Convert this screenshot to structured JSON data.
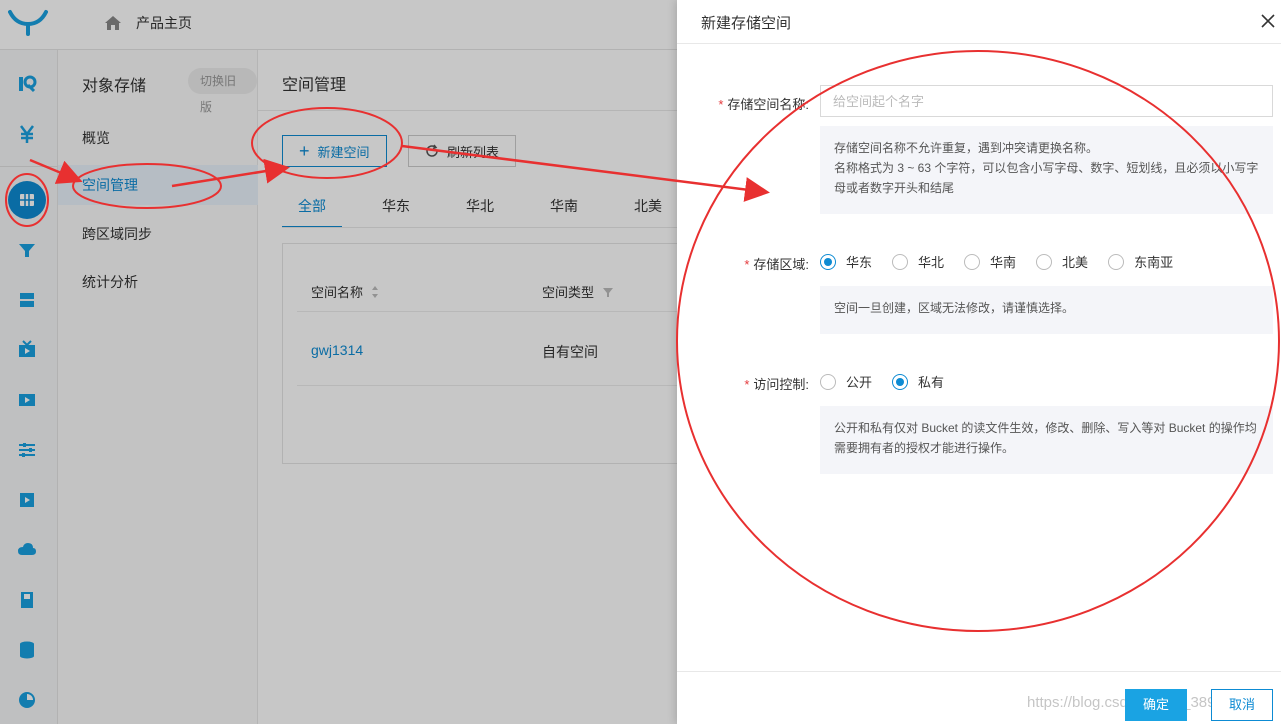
{
  "topbar": {
    "home_label": "产品主页"
  },
  "sidenav": {
    "title": "对象存储",
    "switch_label": "切换旧版",
    "items": [
      {
        "label": "概览"
      },
      {
        "label": "空间管理"
      },
      {
        "label": "跨区域同步"
      },
      {
        "label": "统计分析"
      }
    ]
  },
  "main": {
    "title": "空间管理",
    "new_bucket_label": "新建空间",
    "refresh_label": "刷新列表",
    "region_tabs": [
      "全部",
      "华东",
      "华北",
      "华南",
      "北美"
    ],
    "table": {
      "columns": [
        "空间名称",
        "空间类型"
      ],
      "rows": [
        {
          "name": "gwj1314",
          "type": "自有空间"
        }
      ]
    }
  },
  "drawer": {
    "title": "新建存储空间",
    "name_label": "存储空间名称:",
    "name_placeholder": "给空间起个名字",
    "name_tip_1": "存储空间名称不允许重复，遇到冲突请更换名称。",
    "name_tip_2": "名称格式为 3 ~ 63 个字符，可以包含小写字母、数字、短划线，且必须以小写字母或者数字开头和结尾",
    "region_label": "存储区域:",
    "regions": [
      "华东",
      "华北",
      "华南",
      "北美",
      "东南亚"
    ],
    "region_selected": "华东",
    "region_tip": "空间一旦创建，区域无法修改，请谨慎选择。",
    "access_label": "访问控制:",
    "access_options": [
      "公开",
      "私有"
    ],
    "access_selected": "私有",
    "access_tip": "公开和私有仅对 Bucket 的读文件生效，修改、删除、写入等对 Bucket 的操作均需要拥有者的授权才能进行操作。",
    "ok_label": "确定",
    "cancel_label": "取消",
    "watermark": "https://blog.csdn.net/qq_38960003"
  },
  "colors": {
    "accent": "#0d8bd3",
    "annotation": "#e83030",
    "required": "#e4393c"
  }
}
